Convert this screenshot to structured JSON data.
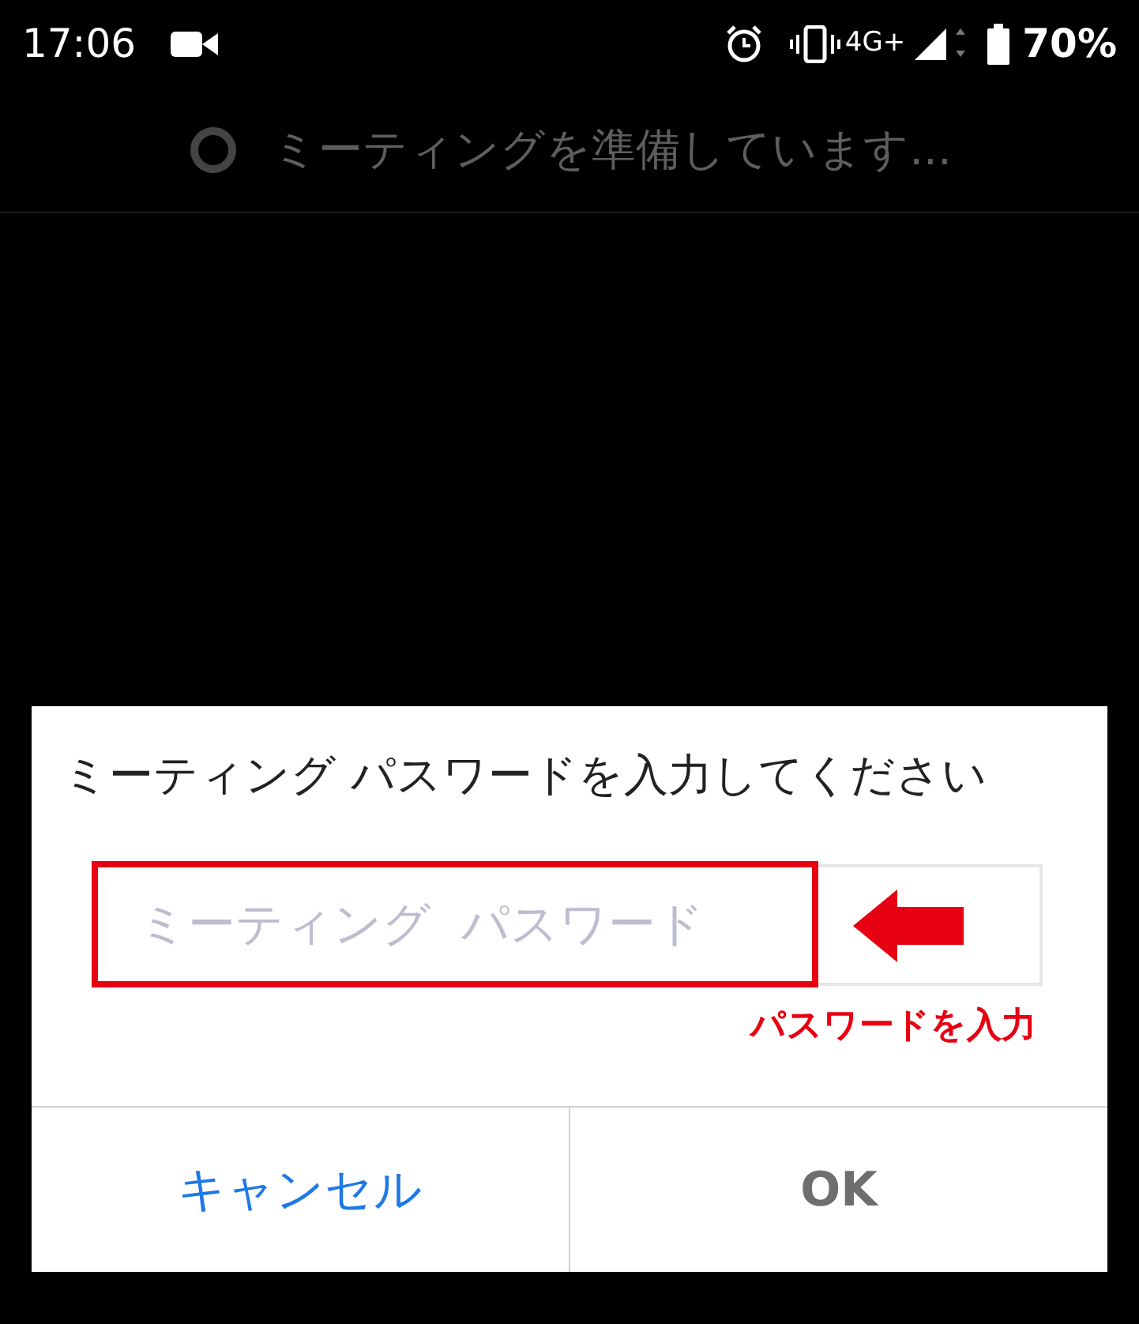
{
  "status_bar": {
    "time": "17:06",
    "network": "4G+",
    "battery": "70%"
  },
  "loading": {
    "text": "ミーティングを準備しています..."
  },
  "dialog": {
    "title": "ミーティング パスワードを入力してください",
    "password_field": {
      "placeholder": "ミーティング  パスワード"
    },
    "annotation": {
      "text": "パスワードを入力"
    },
    "buttons": [
      {
        "label": "キャンセル",
        "kind": "cancel"
      },
      {
        "label": "OK",
        "kind": "confirm"
      }
    ]
  }
}
